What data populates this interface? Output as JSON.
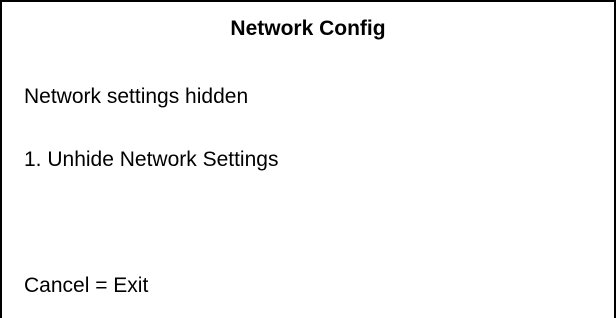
{
  "screen": {
    "title": "Network Config",
    "status_text": "Network settings hidden",
    "menu_items": [
      {
        "label": "1. Unhide Network Settings"
      }
    ],
    "footer_hint": "Cancel = Exit"
  },
  "colors": {
    "background": "#ffffff",
    "text": "#000000",
    "border": "#000000"
  }
}
